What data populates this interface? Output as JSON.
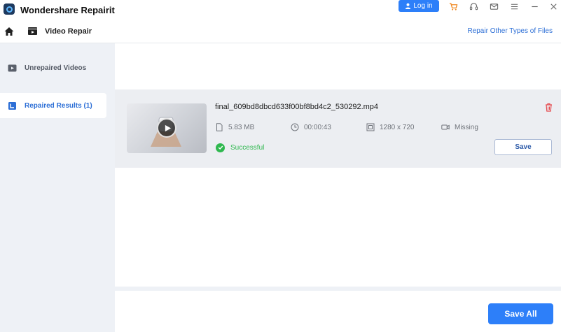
{
  "app": {
    "title": "Wondershare Repairit"
  },
  "titlebar": {
    "login_label": "Log in",
    "icons": [
      "cart-icon",
      "headset-icon",
      "mail-icon",
      "menu-icon",
      "minimize-icon",
      "close-icon"
    ]
  },
  "nav": {
    "title": "Video Repair",
    "repair_other_link": "Repair Other Types of Files"
  },
  "sidebar": {
    "items": [
      {
        "label": "Unrepaired Videos",
        "icon": "video-clip-icon",
        "active": false
      },
      {
        "label": "Repaired Results  (1)",
        "icon": "bookmark-icon",
        "active": true
      }
    ]
  },
  "results": [
    {
      "filename": "final_609bd8dbcd633f00bf8bd4c2_530292.mp4",
      "size": "5.83  MB",
      "duration": "00:00:43",
      "resolution": "1280 x 720",
      "audio": "Missing",
      "status": "Successful",
      "save_label": "Save"
    }
  ],
  "footer": {
    "save_all_label": "Save All"
  },
  "colors": {
    "accent": "#2d7ff9",
    "link": "#2d6fd6",
    "success": "#2fb84f",
    "delete": "#e5484d",
    "sidebar_bg": "#eef1f6",
    "card_bg": "#eceef2"
  }
}
